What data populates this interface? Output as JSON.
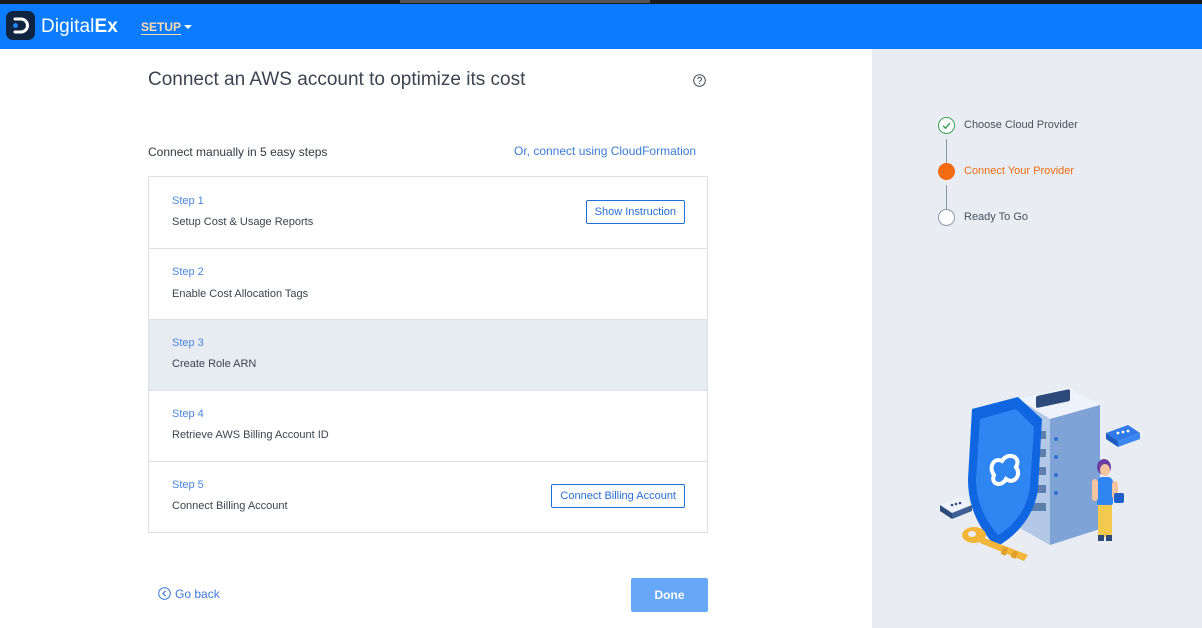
{
  "app": {
    "brand_plain": "Digital",
    "brand_bold": "Ex",
    "setup_menu": "SETUP"
  },
  "main": {
    "title": "Connect an AWS account to optimize its cost",
    "subtitle": "Connect manually in 5 easy steps",
    "cloudformation_link": "Or, connect using CloudFormation",
    "steps": [
      {
        "number": "Step 1",
        "label": "Setup Cost & Usage Reports",
        "button": "Show Instruction"
      },
      {
        "number": "Step 2",
        "label": "Enable Cost Allocation Tags"
      },
      {
        "number": "Step 3",
        "label": "Create Role ARN",
        "active": true
      },
      {
        "number": "Step 4",
        "label": "Retrieve AWS Billing Account ID"
      },
      {
        "number": "Step 5",
        "label": "Connect Billing Account",
        "button": "Connect Billing Account"
      }
    ],
    "go_back": "Go back",
    "done": "Done"
  },
  "progress": {
    "items": [
      {
        "label": "Choose Cloud Provider",
        "state": "complete"
      },
      {
        "label": "Connect Your Provider",
        "state": "current"
      },
      {
        "label": "Ready To Go",
        "state": "pending"
      }
    ]
  },
  "colors": {
    "header_blue": "#0b7cff",
    "link_blue": "#3d7bd8",
    "active_orange": "#f36a10",
    "complete_green": "#3aa15a",
    "done_button": "#66a7f7"
  }
}
